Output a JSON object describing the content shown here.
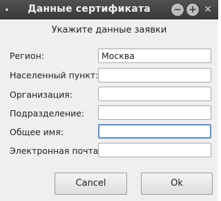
{
  "window": {
    "title": "Данные сертификата",
    "minimize_glyph": "−",
    "maximize_glyph": "+",
    "close_glyph": "✕"
  },
  "form": {
    "heading": "Укажите данные заявки",
    "fields": [
      {
        "label": "Регион:",
        "value": "Москва"
      },
      {
        "label": "Населенный пункт:",
        "value": ""
      },
      {
        "label": "Организация:",
        "value": ""
      },
      {
        "label": "Подразделение:",
        "value": ""
      },
      {
        "label": "Общее имя:",
        "value": ""
      },
      {
        "label": "Электронная почта:",
        "value": ""
      }
    ]
  },
  "buttons": {
    "cancel_label": "Cancel",
    "ok_label": "Ok"
  },
  "colors": {
    "titlebar": "#444444",
    "focus_border": "#5f8dc4"
  }
}
